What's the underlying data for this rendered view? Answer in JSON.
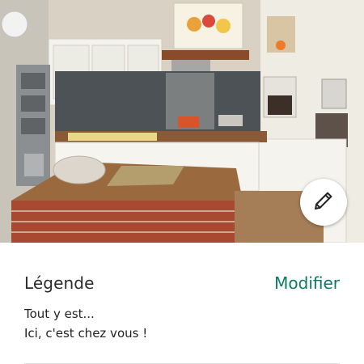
{
  "photo": {
    "subject": "kitchen-photo"
  },
  "edit_button": {
    "icon": "pencil-icon"
  },
  "caption": {
    "title": "Légende",
    "action_label": "Modifier",
    "lines": [
      "Tout y est...",
      "Ici, c'est chez vous !"
    ]
  },
  "colors": {
    "accent": "#0a7a66",
    "text": "#2b2b2b"
  }
}
